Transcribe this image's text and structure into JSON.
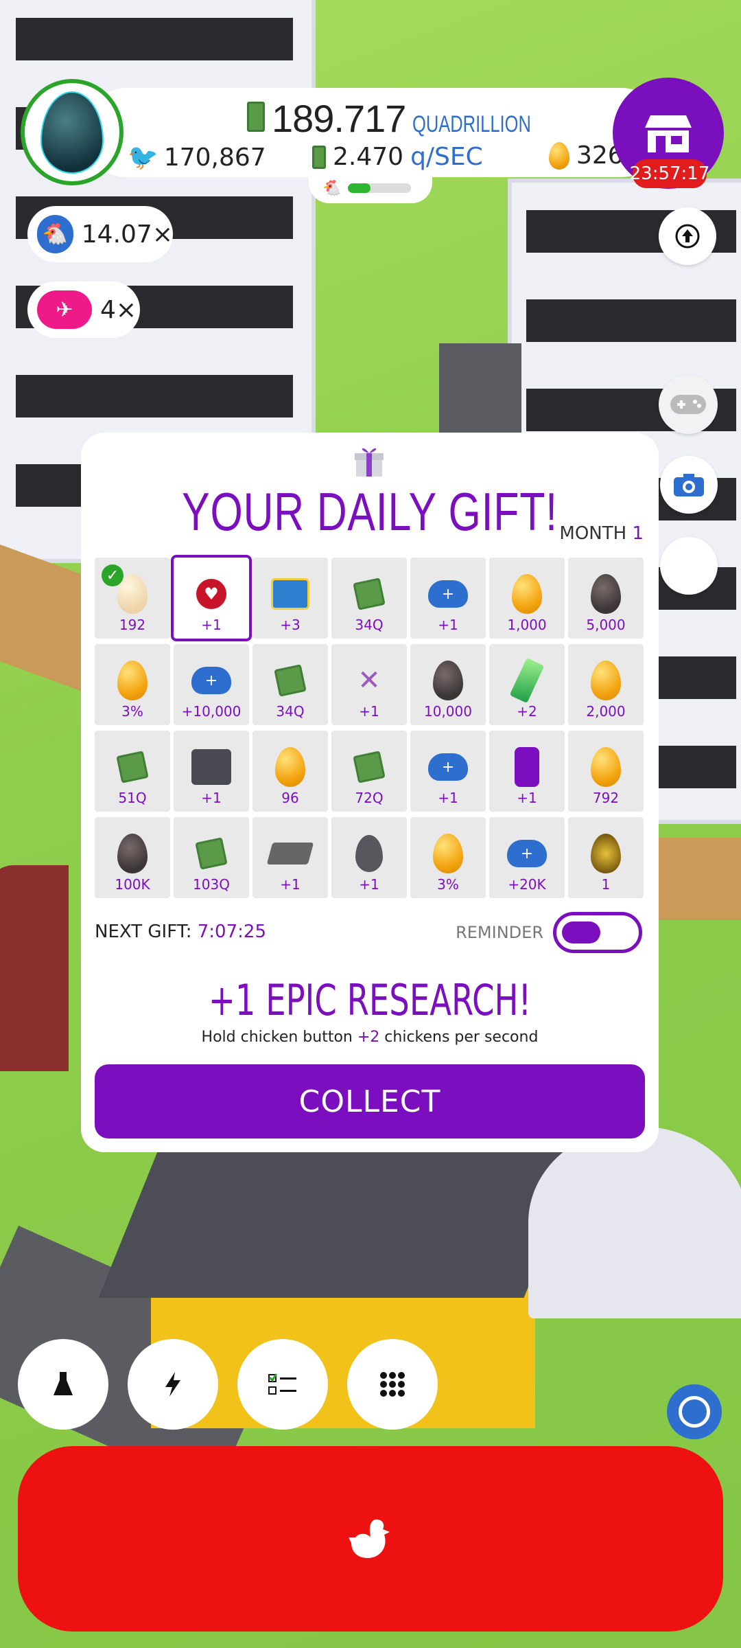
{
  "hud": {
    "money_amount": "189.717",
    "money_unit": "QUADRILLION",
    "rate_value": "2.470",
    "rate_unit": "q/SEC",
    "population": "170,867",
    "golden_eggs": "326",
    "shop_timer": "23:57:17",
    "progress": 0.35
  },
  "boosts": {
    "chicken_multiplier": "14.07×",
    "drone_multiplier": "4×"
  },
  "modal": {
    "title": "YOUR DAILY GIFT!",
    "month_label": "MONTH",
    "month_value": "1",
    "items": [
      {
        "label": "192",
        "icon": "cream-egg-icon",
        "claimed": true
      },
      {
        "label": "+1",
        "icon": "click-icon",
        "active": true
      },
      {
        "label": "+3",
        "icon": "box-icon"
      },
      {
        "label": "34Q",
        "icon": "cash-icon"
      },
      {
        "label": "+1",
        "icon": "piggy-bank-icon"
      },
      {
        "label": "1,000",
        "icon": "golden-egg-icon"
      },
      {
        "label": "5,000",
        "icon": "dark-egg-icon"
      },
      {
        "label": "3%",
        "icon": "golden-egg-icon"
      },
      {
        "label": "+10,000",
        "icon": "piggy-bank-icon"
      },
      {
        "label": "34Q",
        "icon": "cash-icon"
      },
      {
        "label": "+1",
        "icon": "chicken-icon"
      },
      {
        "label": "10,000",
        "icon": "dark-egg-icon"
      },
      {
        "label": "+2",
        "icon": "gem-icon"
      },
      {
        "label": "2,000",
        "icon": "golden-egg-icon"
      },
      {
        "label": "51Q",
        "icon": "cash-icon"
      },
      {
        "label": "+1",
        "icon": "drone-icon"
      },
      {
        "label": "96",
        "icon": "golden-egg-icon"
      },
      {
        "label": "72Q",
        "icon": "cash-icon"
      },
      {
        "label": "+1",
        "icon": "piggy-bank-icon"
      },
      {
        "label": "+1",
        "icon": "washer-icon"
      },
      {
        "label": "792",
        "icon": "golden-egg-icon"
      },
      {
        "label": "100K",
        "icon": "dark-egg-icon"
      },
      {
        "label": "103Q",
        "icon": "cash-icon"
      },
      {
        "label": "+1",
        "icon": "cash-tray-icon"
      },
      {
        "label": "+1",
        "icon": "shield-egg-icon"
      },
      {
        "label": "3%",
        "icon": "golden-egg-icon"
      },
      {
        "label": "+20K",
        "icon": "piggy-bank-icon"
      },
      {
        "label": "1",
        "icon": "gold-artifact-egg-icon"
      }
    ],
    "next_gift_label": "NEXT GIFT:",
    "next_gift_time": "7:07:25",
    "reminder_label": "REMINDER",
    "reward_title": "+1 EPIC RESEARCH!",
    "reward_desc_a": "Hold chicken button ",
    "reward_desc_b": "+2",
    "reward_desc_c": " chickens per second",
    "collect_label": "COLLECT"
  },
  "colors": {
    "purple": "#7b0fc0",
    "blue": "#2d6ecf",
    "red": "#ee1111",
    "green": "#2aa52a"
  }
}
